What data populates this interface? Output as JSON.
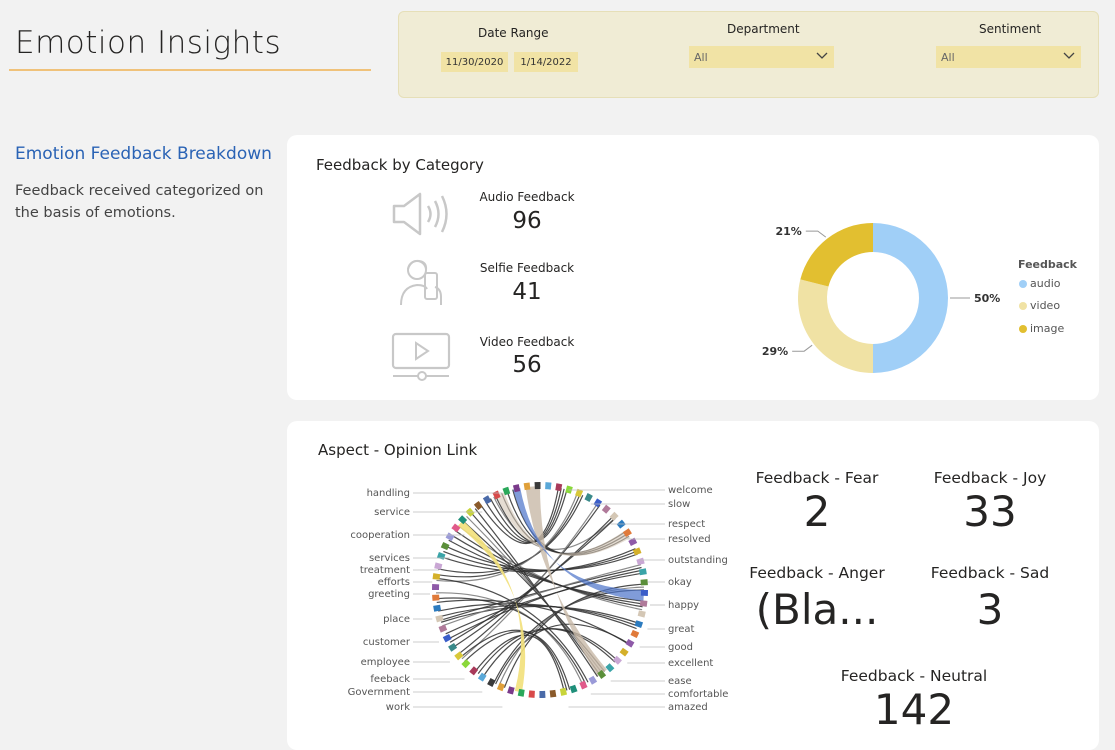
{
  "header": {
    "title": "Emotion Insights"
  },
  "filters": {
    "date_range": {
      "label": "Date Range",
      "start": "11/30/2020",
      "end": "1/14/2022"
    },
    "department": {
      "label": "Department",
      "value": "All"
    },
    "sentiment": {
      "label": "Sentiment",
      "value": "All"
    }
  },
  "sidebar": {
    "heading": "Emotion Feedback Breakdown",
    "description": "Feedback received categorized on the basis of emotions."
  },
  "category_card": {
    "title": "Feedback by Category",
    "metrics": [
      {
        "label": "Audio Feedback",
        "value": "96",
        "icon": "speaker-icon"
      },
      {
        "label": "Selfie Feedback",
        "value": "41",
        "icon": "selfie-icon"
      },
      {
        "label": "Video Feedback",
        "value": "56",
        "icon": "video-icon"
      }
    ]
  },
  "chart_data": {
    "type": "pie",
    "variant": "donut",
    "legend_title": "Feedback",
    "legend_placement": "right",
    "categories": [
      "audio",
      "video",
      "image"
    ],
    "values": [
      50,
      29,
      21
    ],
    "labels": [
      "50%",
      "29%",
      "21%"
    ],
    "colors": [
      "#a0cff7",
      "#f0e2a4",
      "#e2bf30"
    ]
  },
  "aspect_card": {
    "title": "Aspect - Opinion Link",
    "left_labels": [
      "handling",
      "service",
      "cooperation",
      "services",
      "treatment",
      "efforts",
      "greeting",
      "place",
      "customer",
      "employee",
      "feeback",
      "Government",
      "work"
    ],
    "right_labels": [
      "welcome",
      "slow",
      "respect",
      "resolved",
      "outstanding",
      "okay",
      "happy",
      "great",
      "good",
      "excellent",
      "ease",
      "comfortable",
      "amazed"
    ]
  },
  "emotions": {
    "fear": {
      "label": "Feedback - Fear",
      "value": "2"
    },
    "joy": {
      "label": "Feedback - Joy",
      "value": "33"
    },
    "anger": {
      "label": "Feedback - Anger",
      "value": "(Bla..."
    },
    "sad": {
      "label": "Feedback - Sad",
      "value": "3"
    },
    "neutral": {
      "label": "Feedback - Neutral",
      "value": "142"
    }
  }
}
